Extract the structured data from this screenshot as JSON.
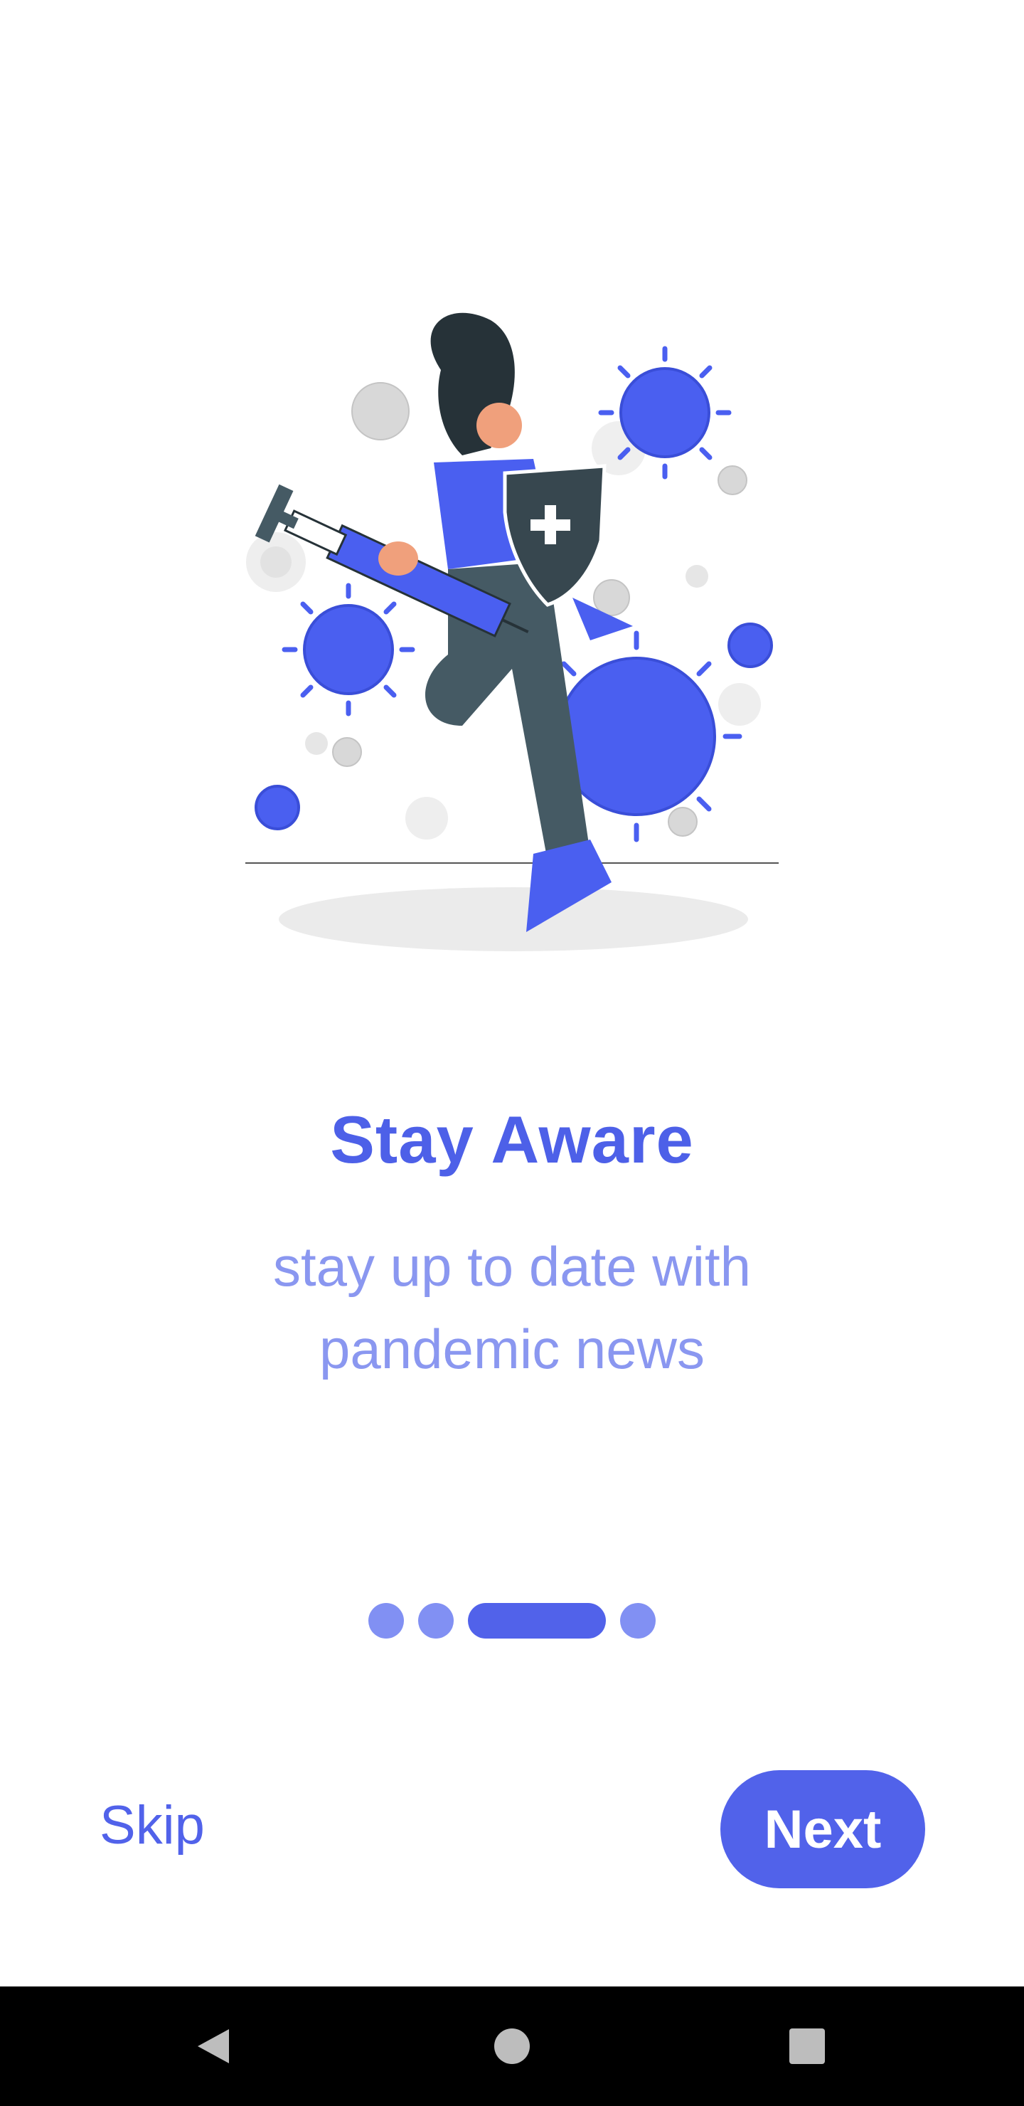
{
  "onboarding": {
    "title": "Stay Aware",
    "subtitle_line1": "stay up to date with",
    "subtitle_line2": "pandemic news",
    "page_indicator": {
      "total": 4,
      "current": 3
    }
  },
  "actions": {
    "skip_label": "Skip",
    "next_label": "Next"
  },
  "navbar": {
    "back_icon": "back-triangle-icon",
    "home_icon": "home-circle-icon",
    "recents_icon": "recents-square-icon"
  },
  "colors": {
    "accent": "#5162ea",
    "accent_light": "#8a97f0",
    "virus_blue": "#4a5ff0",
    "virus_gray": "#d6d6d6"
  }
}
